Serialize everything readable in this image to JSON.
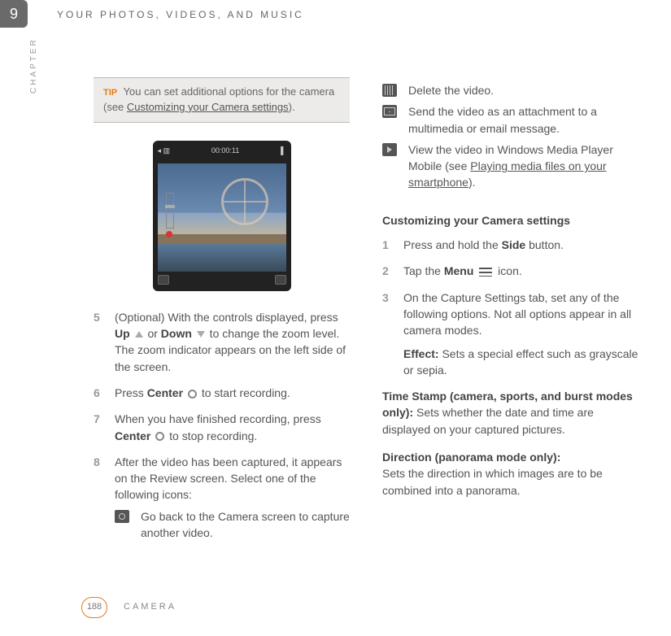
{
  "chapter": {
    "number": "9",
    "label_v": "CHAPTER",
    "header": "YOUR PHOTOS, VIDEOS, AND MUSIC"
  },
  "tip": {
    "label": "TIP",
    "pre": "You can set additional options for the camera (see ",
    "link": "Customizing your Camera settings",
    "post": ")."
  },
  "screenshot": {
    "timecode": "00:00:11",
    "rec_icon": true
  },
  "left_steps": {
    "s5": {
      "n": "5",
      "pre": "(Optional) With the controls displayed, press ",
      "up": "Up",
      "mid1": " or ",
      "down": "Down",
      "post": " to change the zoom level. The zoom indicator appears on the left side of the screen."
    },
    "s6": {
      "n": "6",
      "pre": "Press ",
      "center": "Center",
      "post": " to start recording."
    },
    "s7": {
      "n": "7",
      "pre": "When you have finished recording, press ",
      "center": "Center",
      "post": " to stop recording."
    },
    "s8": {
      "n": "8",
      "text": "After the video has been captured, it appears on the Review screen. Select one of the following icons:"
    },
    "camera_desc": "Go back to the Camera screen to capture another video."
  },
  "right_icons": {
    "trash": "Delete the video.",
    "mail": "Send the video as an attachment to a multimedia or email message.",
    "play_pre": "View the video in Windows Media Player Mobile (see ",
    "play_link": "Playing media files on your smartphone",
    "play_post": ")."
  },
  "customize": {
    "heading": "Customizing your Camera settings",
    "s1": {
      "n": "1",
      "pre": "Press and hold the ",
      "side": "Side",
      "post": " button."
    },
    "s2": {
      "n": "2",
      "pre": "Tap the ",
      "menu": "Menu",
      "post": " icon."
    },
    "s3": {
      "n": "3",
      "text": "On the Capture Settings tab, set any of the following options. Not all options appear in all camera modes."
    },
    "effect_label": "Effect:",
    "effect_text": " Sets a special effect such as grayscale or sepia.",
    "ts_label": "Time Stamp (camera, sports, and burst modes only):",
    "ts_text": " Sets whether the date and time are displayed on your captured pictures.",
    "dir_label": "Direction (panorama mode only):",
    "dir_text": "Sets the direction in which images are to be combined into a panorama."
  },
  "footer": {
    "page": "188",
    "section": "CAMERA"
  }
}
